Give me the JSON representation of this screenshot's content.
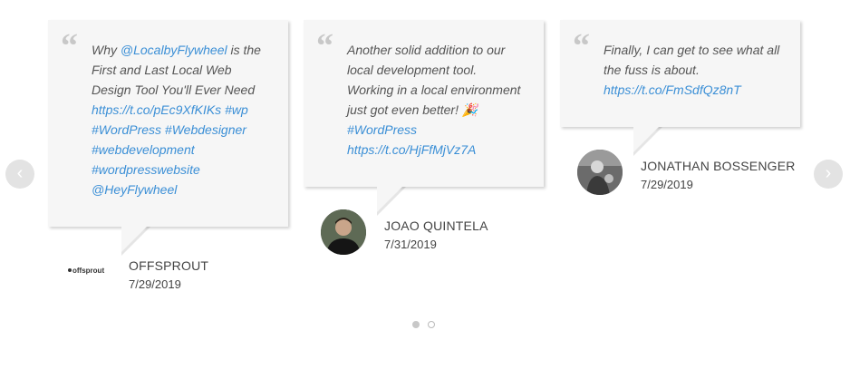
{
  "slider": {
    "prev_icon": "chevron-left-icon",
    "next_icon": "chevron-right-icon",
    "pagination": {
      "active_index": 0,
      "count": 2
    }
  },
  "testimonials": [
    {
      "segments": [
        {
          "t": "Why "
        },
        {
          "t": "@LocalbyFlywheel",
          "link": true
        },
        {
          "t": " is the First and Last Local Web Design Tool You'll Ever Need "
        },
        {
          "t": "https://t.co/pEc9XfKIKs",
          "link": true
        },
        {
          "t": " "
        },
        {
          "t": "#wp",
          "link": true
        },
        {
          "t": " "
        },
        {
          "t": "#WordPress",
          "link": true
        },
        {
          "t": " "
        },
        {
          "t": "#Webdesigner",
          "link": true
        },
        {
          "t": " "
        },
        {
          "t": "#webdevelopment",
          "link": true
        },
        {
          "t": " "
        },
        {
          "t": "#wordpresswebsite",
          "link": true
        },
        {
          "t": " "
        },
        {
          "t": "@HeyFlywheel",
          "link": true
        }
      ],
      "author": "OFFSPROUT",
      "date": "7/29/2019",
      "logo_text": "offsprout"
    },
    {
      "segments": [
        {
          "t": "Another solid addition to our local development tool. Working in a local environment just got even better! 🎉 "
        },
        {
          "t": "#WordPress",
          "link": true
        },
        {
          "t": " "
        },
        {
          "t": "https://t.co/HjFfMjVz7A",
          "link": true
        }
      ],
      "author": "JOAO QUINTELA",
      "date": "7/31/2019"
    },
    {
      "segments": [
        {
          "t": "Finally, I can get to see what all the fuss is about. "
        },
        {
          "t": "https://t.co/FmSdfQz8nT",
          "link": true
        }
      ],
      "author": "JONATHAN BOSSENGER",
      "date": "7/29/2019"
    }
  ],
  "colors": {
    "link": "#3b8fd6",
    "card_bg": "#f6f6f6",
    "quote_mark": "#c8c8c8",
    "arrow_bg": "#e3e3e3"
  }
}
